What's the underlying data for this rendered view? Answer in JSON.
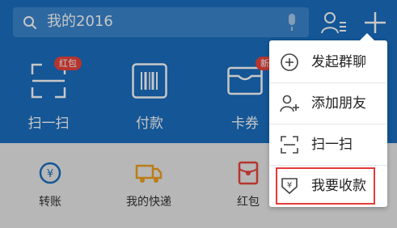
{
  "search": {
    "text": "我的2016"
  },
  "shortcuts": [
    {
      "label": "扫一扫",
      "icon": "scan-icon",
      "badge": "红包"
    },
    {
      "label": "付款",
      "icon": "barcode-icon"
    },
    {
      "label": "卡券",
      "icon": "card-icon",
      "badge": "新"
    }
  ],
  "bottom_items": [
    {
      "label": "转账",
      "icon": "transfer-icon"
    },
    {
      "label": "我的快递",
      "icon": "truck-icon"
    },
    {
      "label": "红包",
      "icon": "red-envelope-icon"
    }
  ],
  "menu": {
    "items": [
      {
        "label": "发起群聊",
        "icon": "group-chat-icon"
      },
      {
        "label": "添加朋友",
        "icon": "add-friend-icon"
      },
      {
        "label": "扫一扫",
        "icon": "scan-icon"
      },
      {
        "label": "我要收款",
        "icon": "receive-money-icon",
        "highlighted": true
      }
    ]
  },
  "colors": {
    "header_blue": "#1a6fc0",
    "badge_red": "#e8453c",
    "highlight_red": "#e53a3a",
    "accent_orange": "#f0a020"
  }
}
